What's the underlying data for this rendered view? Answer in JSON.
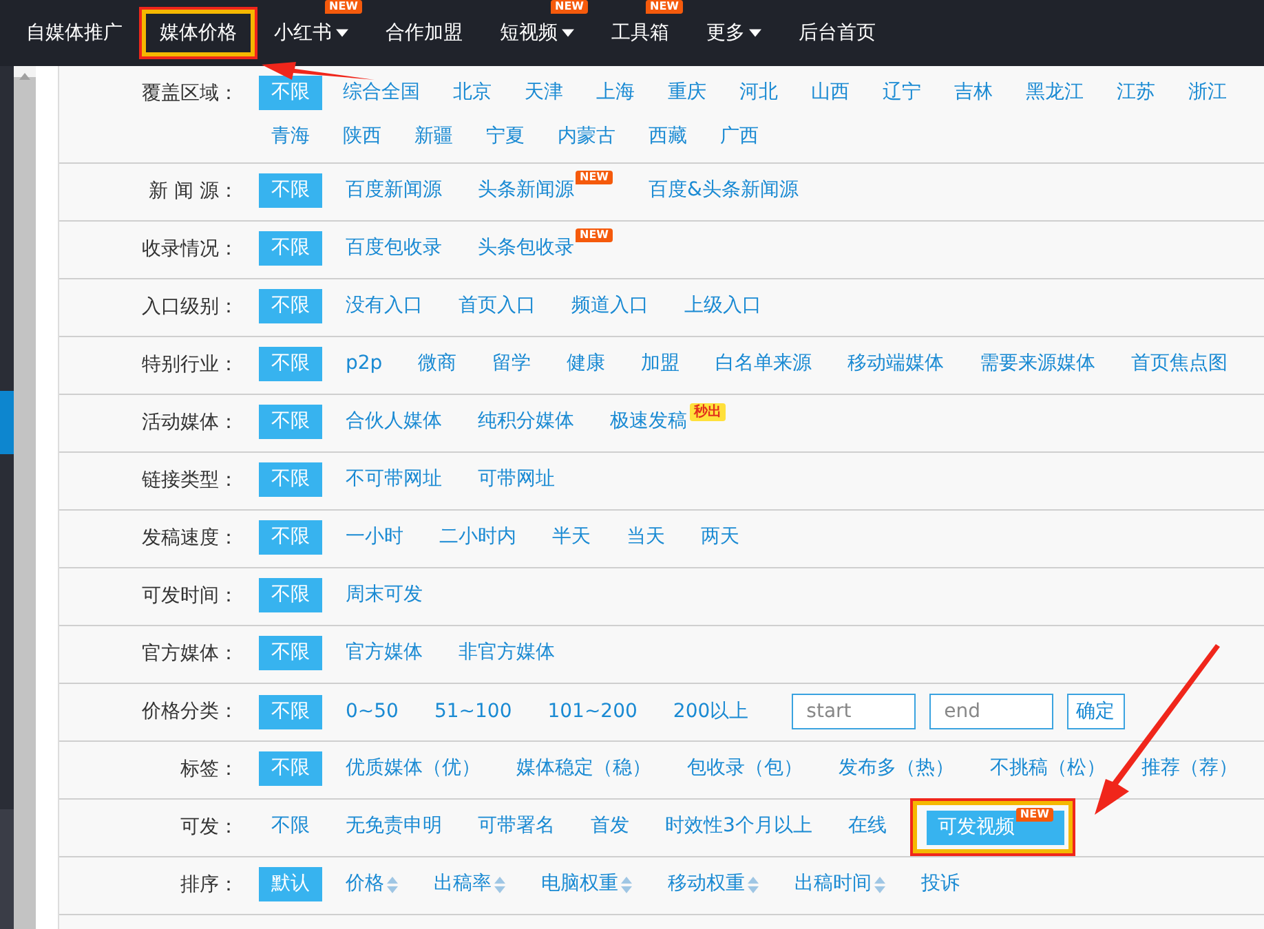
{
  "nav": {
    "items": [
      {
        "label": "自媒体推广",
        "dropdown": false,
        "highlighted": false
      },
      {
        "label": "媒体价格",
        "dropdown": false,
        "highlighted": true
      },
      {
        "label": "小红书",
        "dropdown": true,
        "highlighted": false,
        "badge": "NEW"
      },
      {
        "label": "合作加盟",
        "dropdown": false,
        "highlighted": false
      },
      {
        "label": "短视频",
        "dropdown": true,
        "highlighted": false,
        "badge": "NEW"
      },
      {
        "label": "工具箱",
        "dropdown": false,
        "highlighted": false,
        "badge": "NEW"
      },
      {
        "label": "更多",
        "dropdown": true,
        "highlighted": false
      },
      {
        "label": "后台首页",
        "dropdown": false,
        "highlighted": false
      }
    ]
  },
  "filters": [
    {
      "label": "覆盖区域：",
      "options": [
        {
          "text": "不限",
          "selected": true
        },
        {
          "text": "综合全国",
          "selected": false
        },
        {
          "text": "北京",
          "selected": false
        },
        {
          "text": "天津",
          "selected": false
        },
        {
          "text": "上海",
          "selected": false
        },
        {
          "text": "重庆",
          "selected": false
        },
        {
          "text": "河北",
          "selected": false
        },
        {
          "text": "山西",
          "selected": false
        },
        {
          "text": "辽宁",
          "selected": false
        },
        {
          "text": "吉林",
          "selected": false
        },
        {
          "text": "黑龙江",
          "selected": false
        },
        {
          "text": "江苏",
          "selected": false
        },
        {
          "text": "浙江",
          "selected": false
        },
        {
          "text": "青海",
          "selected": false
        },
        {
          "text": "陕西",
          "selected": false
        },
        {
          "text": "新疆",
          "selected": false
        },
        {
          "text": "宁夏",
          "selected": false
        },
        {
          "text": "内蒙古",
          "selected": false
        },
        {
          "text": "西藏",
          "selected": false
        },
        {
          "text": "广西",
          "selected": false
        }
      ]
    },
    {
      "label": "新 闻 源：",
      "options": [
        {
          "text": "不限",
          "selected": true
        },
        {
          "text": "百度新闻源",
          "selected": false
        },
        {
          "text": "头条新闻源",
          "selected": false,
          "badge": {
            "text": "NEW",
            "kind": "new"
          }
        },
        {
          "text": "百度&头条新闻源",
          "selected": false
        }
      ]
    },
    {
      "label": "收录情况：",
      "options": [
        {
          "text": "不限",
          "selected": true
        },
        {
          "text": "百度包收录",
          "selected": false
        },
        {
          "text": "头条包收录",
          "selected": false,
          "badge": {
            "text": "NEW",
            "kind": "new"
          }
        }
      ]
    },
    {
      "label": "入口级别：",
      "options": [
        {
          "text": "不限",
          "selected": true
        },
        {
          "text": "没有入口",
          "selected": false
        },
        {
          "text": "首页入口",
          "selected": false
        },
        {
          "text": "频道入口",
          "selected": false
        },
        {
          "text": "上级入口",
          "selected": false
        }
      ]
    },
    {
      "label": "特别行业：",
      "options": [
        {
          "text": "不限",
          "selected": true
        },
        {
          "text": "p2p",
          "selected": false
        },
        {
          "text": "微商",
          "selected": false
        },
        {
          "text": "留学",
          "selected": false
        },
        {
          "text": "健康",
          "selected": false
        },
        {
          "text": "加盟",
          "selected": false
        },
        {
          "text": "白名单来源",
          "selected": false
        },
        {
          "text": "移动端媒体",
          "selected": false
        },
        {
          "text": "需要来源媒体",
          "selected": false
        },
        {
          "text": "首页焦点图",
          "selected": false
        }
      ]
    },
    {
      "label": "活动媒体：",
      "options": [
        {
          "text": "不限",
          "selected": true
        },
        {
          "text": "合伙人媒体",
          "selected": false
        },
        {
          "text": "纯积分媒体",
          "selected": false
        },
        {
          "text": "极速发稿",
          "selected": false,
          "badge": {
            "text": "秒出",
            "kind": "hot"
          }
        }
      ]
    },
    {
      "label": "链接类型：",
      "options": [
        {
          "text": "不限",
          "selected": true
        },
        {
          "text": "不可带网址",
          "selected": false
        },
        {
          "text": "可带网址",
          "selected": false
        }
      ]
    },
    {
      "label": "发稿速度：",
      "options": [
        {
          "text": "不限",
          "selected": true
        },
        {
          "text": "一小时",
          "selected": false
        },
        {
          "text": "二小时内",
          "selected": false
        },
        {
          "text": "半天",
          "selected": false
        },
        {
          "text": "当天",
          "selected": false
        },
        {
          "text": "两天",
          "selected": false
        }
      ]
    },
    {
      "label": "可发时间：",
      "options": [
        {
          "text": "不限",
          "selected": true
        },
        {
          "text": "周末可发",
          "selected": false
        }
      ]
    },
    {
      "label": "官方媒体：",
      "options": [
        {
          "text": "不限",
          "selected": true
        },
        {
          "text": "官方媒体",
          "selected": false
        },
        {
          "text": "非官方媒体",
          "selected": false
        }
      ]
    },
    {
      "label": "价格分类：",
      "options": [
        {
          "text": "不限",
          "selected": true
        },
        {
          "text": "0~50",
          "selected": false
        },
        {
          "text": "51~100",
          "selected": false
        },
        {
          "text": "101~200",
          "selected": false
        },
        {
          "text": "200以上",
          "selected": false
        }
      ],
      "range": {
        "start_placeholder": "start",
        "end_placeholder": "end",
        "button": "确定"
      }
    },
    {
      "label": "标签：",
      "options": [
        {
          "text": "不限",
          "selected": true
        },
        {
          "text": "优质媒体（优）",
          "selected": false
        },
        {
          "text": "媒体稳定（稳）",
          "selected": false
        },
        {
          "text": "包收录（包）",
          "selected": false
        },
        {
          "text": "发布多（热）",
          "selected": false
        },
        {
          "text": "不挑稿（松）",
          "selected": false
        },
        {
          "text": "推荐（荐）",
          "selected": false
        }
      ]
    },
    {
      "label": "可发：",
      "options": [
        {
          "text": "不限",
          "selected": false,
          "highlighted": false
        },
        {
          "text": "无免责申明",
          "selected": false,
          "highlighted": false
        },
        {
          "text": "可带署名",
          "selected": false,
          "highlighted": false
        },
        {
          "text": "首发",
          "selected": false,
          "highlighted": false
        },
        {
          "text": "时效性3个月以上",
          "selected": false,
          "highlighted": false
        },
        {
          "text": "在线",
          "selected": false,
          "highlighted": false
        },
        {
          "text": "可发视频",
          "selected": true,
          "highlighted": true,
          "badge": {
            "text": "NEW",
            "kind": "new"
          }
        }
      ]
    },
    {
      "label": "排序：",
      "options": [
        {
          "text": "默认",
          "selected": true,
          "sortable": false
        },
        {
          "text": "价格",
          "selected": false,
          "sortable": true
        },
        {
          "text": "出稿率",
          "selected": false,
          "sortable": true
        },
        {
          "text": "电脑权重",
          "selected": false,
          "sortable": true
        },
        {
          "text": "移动权重",
          "selected": false,
          "sortable": true
        },
        {
          "text": "出稿时间",
          "selected": false,
          "sortable": true
        },
        {
          "text": "投诉",
          "selected": false,
          "sortable": false
        }
      ]
    }
  ]
}
